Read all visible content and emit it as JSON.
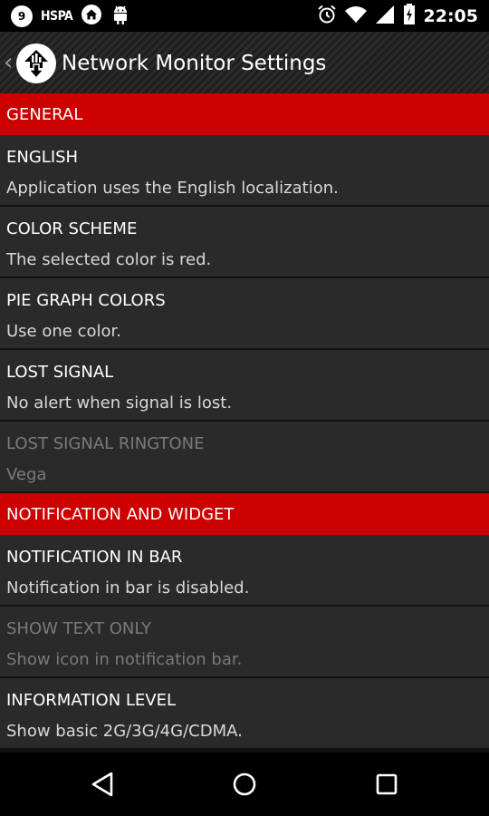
{
  "status_bar": {
    "badge": "9",
    "network": "HSPA",
    "time": "22:05"
  },
  "action_bar": {
    "title": "Network Monitor Settings"
  },
  "sections": [
    {
      "header": "GENERAL",
      "items": [
        {
          "title": "ENGLISH",
          "summary": "Application uses the English localization.",
          "enabled": true
        },
        {
          "title": "COLOR SCHEME",
          "summary": "The selected color is red.",
          "enabled": true
        },
        {
          "title": "PIE GRAPH COLORS",
          "summary": "Use one color.",
          "enabled": true
        },
        {
          "title": "LOST SIGNAL",
          "summary": "No alert when signal is lost.",
          "enabled": true
        },
        {
          "title": "LOST SIGNAL RINGTONE",
          "summary": "Vega",
          "enabled": false
        }
      ]
    },
    {
      "header": "NOTIFICATION AND WIDGET",
      "items": [
        {
          "title": "NOTIFICATION IN BAR",
          "summary": "Notification in bar is disabled.",
          "enabled": true
        },
        {
          "title": "SHOW TEXT ONLY",
          "summary": "Show icon in notification bar.",
          "enabled": false
        },
        {
          "title": "INFORMATION LEVEL",
          "summary": "Show basic 2G/3G/4G/CDMA.",
          "enabled": true
        }
      ]
    }
  ],
  "colors": {
    "accent": "#cc0000",
    "row_bg": "#2a2a2a",
    "disabled_text": "#7a7a7a"
  },
  "icons": [
    "home-icon",
    "android-icon",
    "alarm-icon",
    "wifi-icon",
    "signal-icon",
    "battery-icon",
    "back-icon",
    "home-circle-icon",
    "recents-icon"
  ]
}
